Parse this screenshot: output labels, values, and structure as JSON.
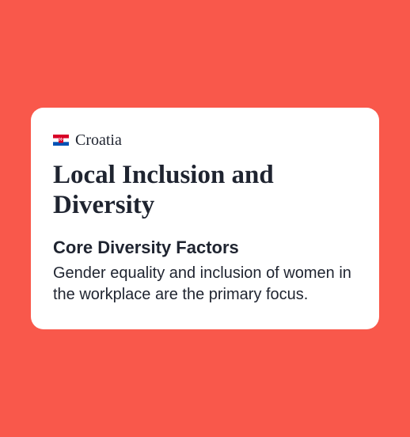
{
  "country": {
    "name": "Croatia",
    "flag_icon": "croatia-flag"
  },
  "title": "Local Inclusion and Diversity",
  "section": {
    "heading": "Core Diversity Factors",
    "body": "Gender equality and inclusion of women in the workplace are the primary focus."
  }
}
